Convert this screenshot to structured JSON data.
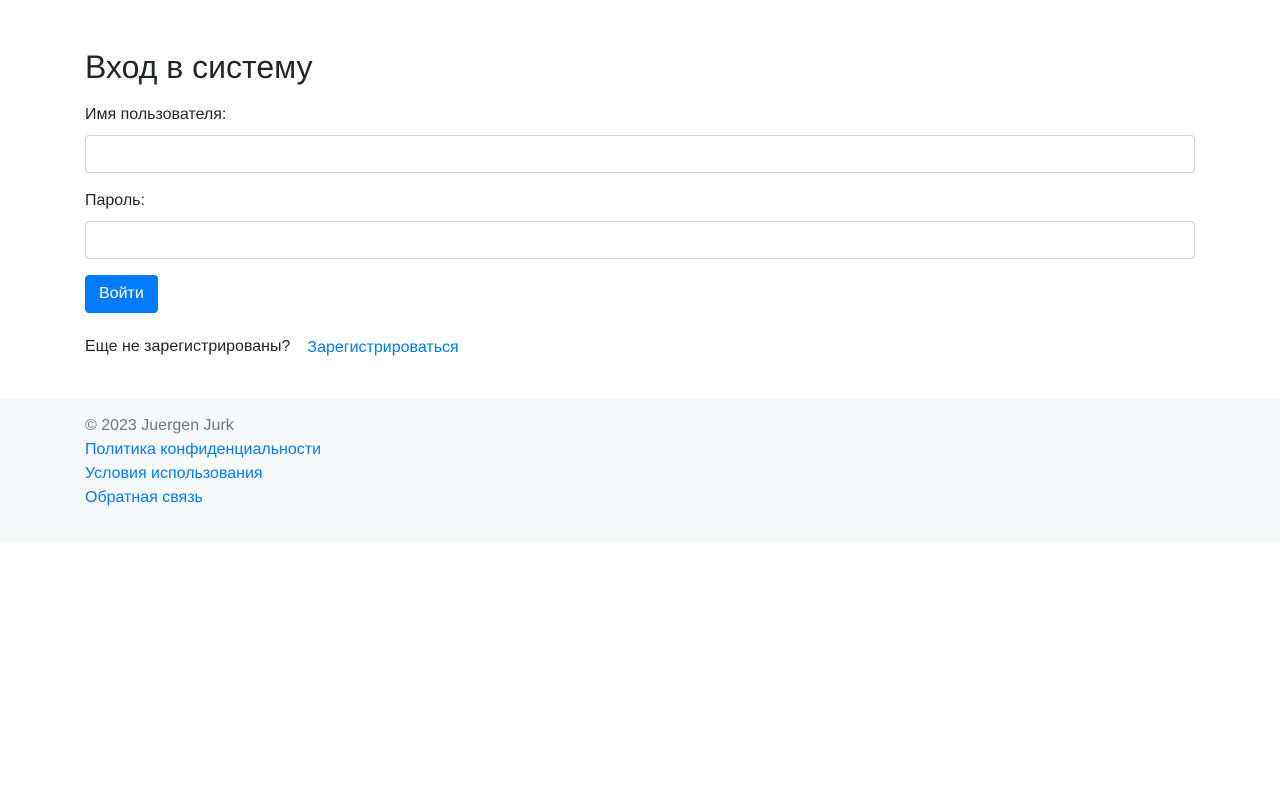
{
  "page": {
    "title": "Вход в систему"
  },
  "form": {
    "username_label": "Имя пользователя:",
    "username_value": "",
    "password_label": "Пароль:",
    "password_value": "",
    "submit_label": "Войти"
  },
  "register": {
    "prompt": "Еще не зарегистрированы?",
    "link_label": "Зарегистрироваться"
  },
  "footer": {
    "copyright": "© 2023 Juergen Jurk",
    "links": [
      {
        "label": "Политика конфиденциальности"
      },
      {
        "label": "Условия использования"
      },
      {
        "label": "Обратная связь"
      }
    ]
  },
  "colors": {
    "primary": "#007bff",
    "text": "#212529",
    "muted": "#6c757d",
    "footer_bg": "#f8f9fa",
    "input_border": "#ced4da"
  }
}
